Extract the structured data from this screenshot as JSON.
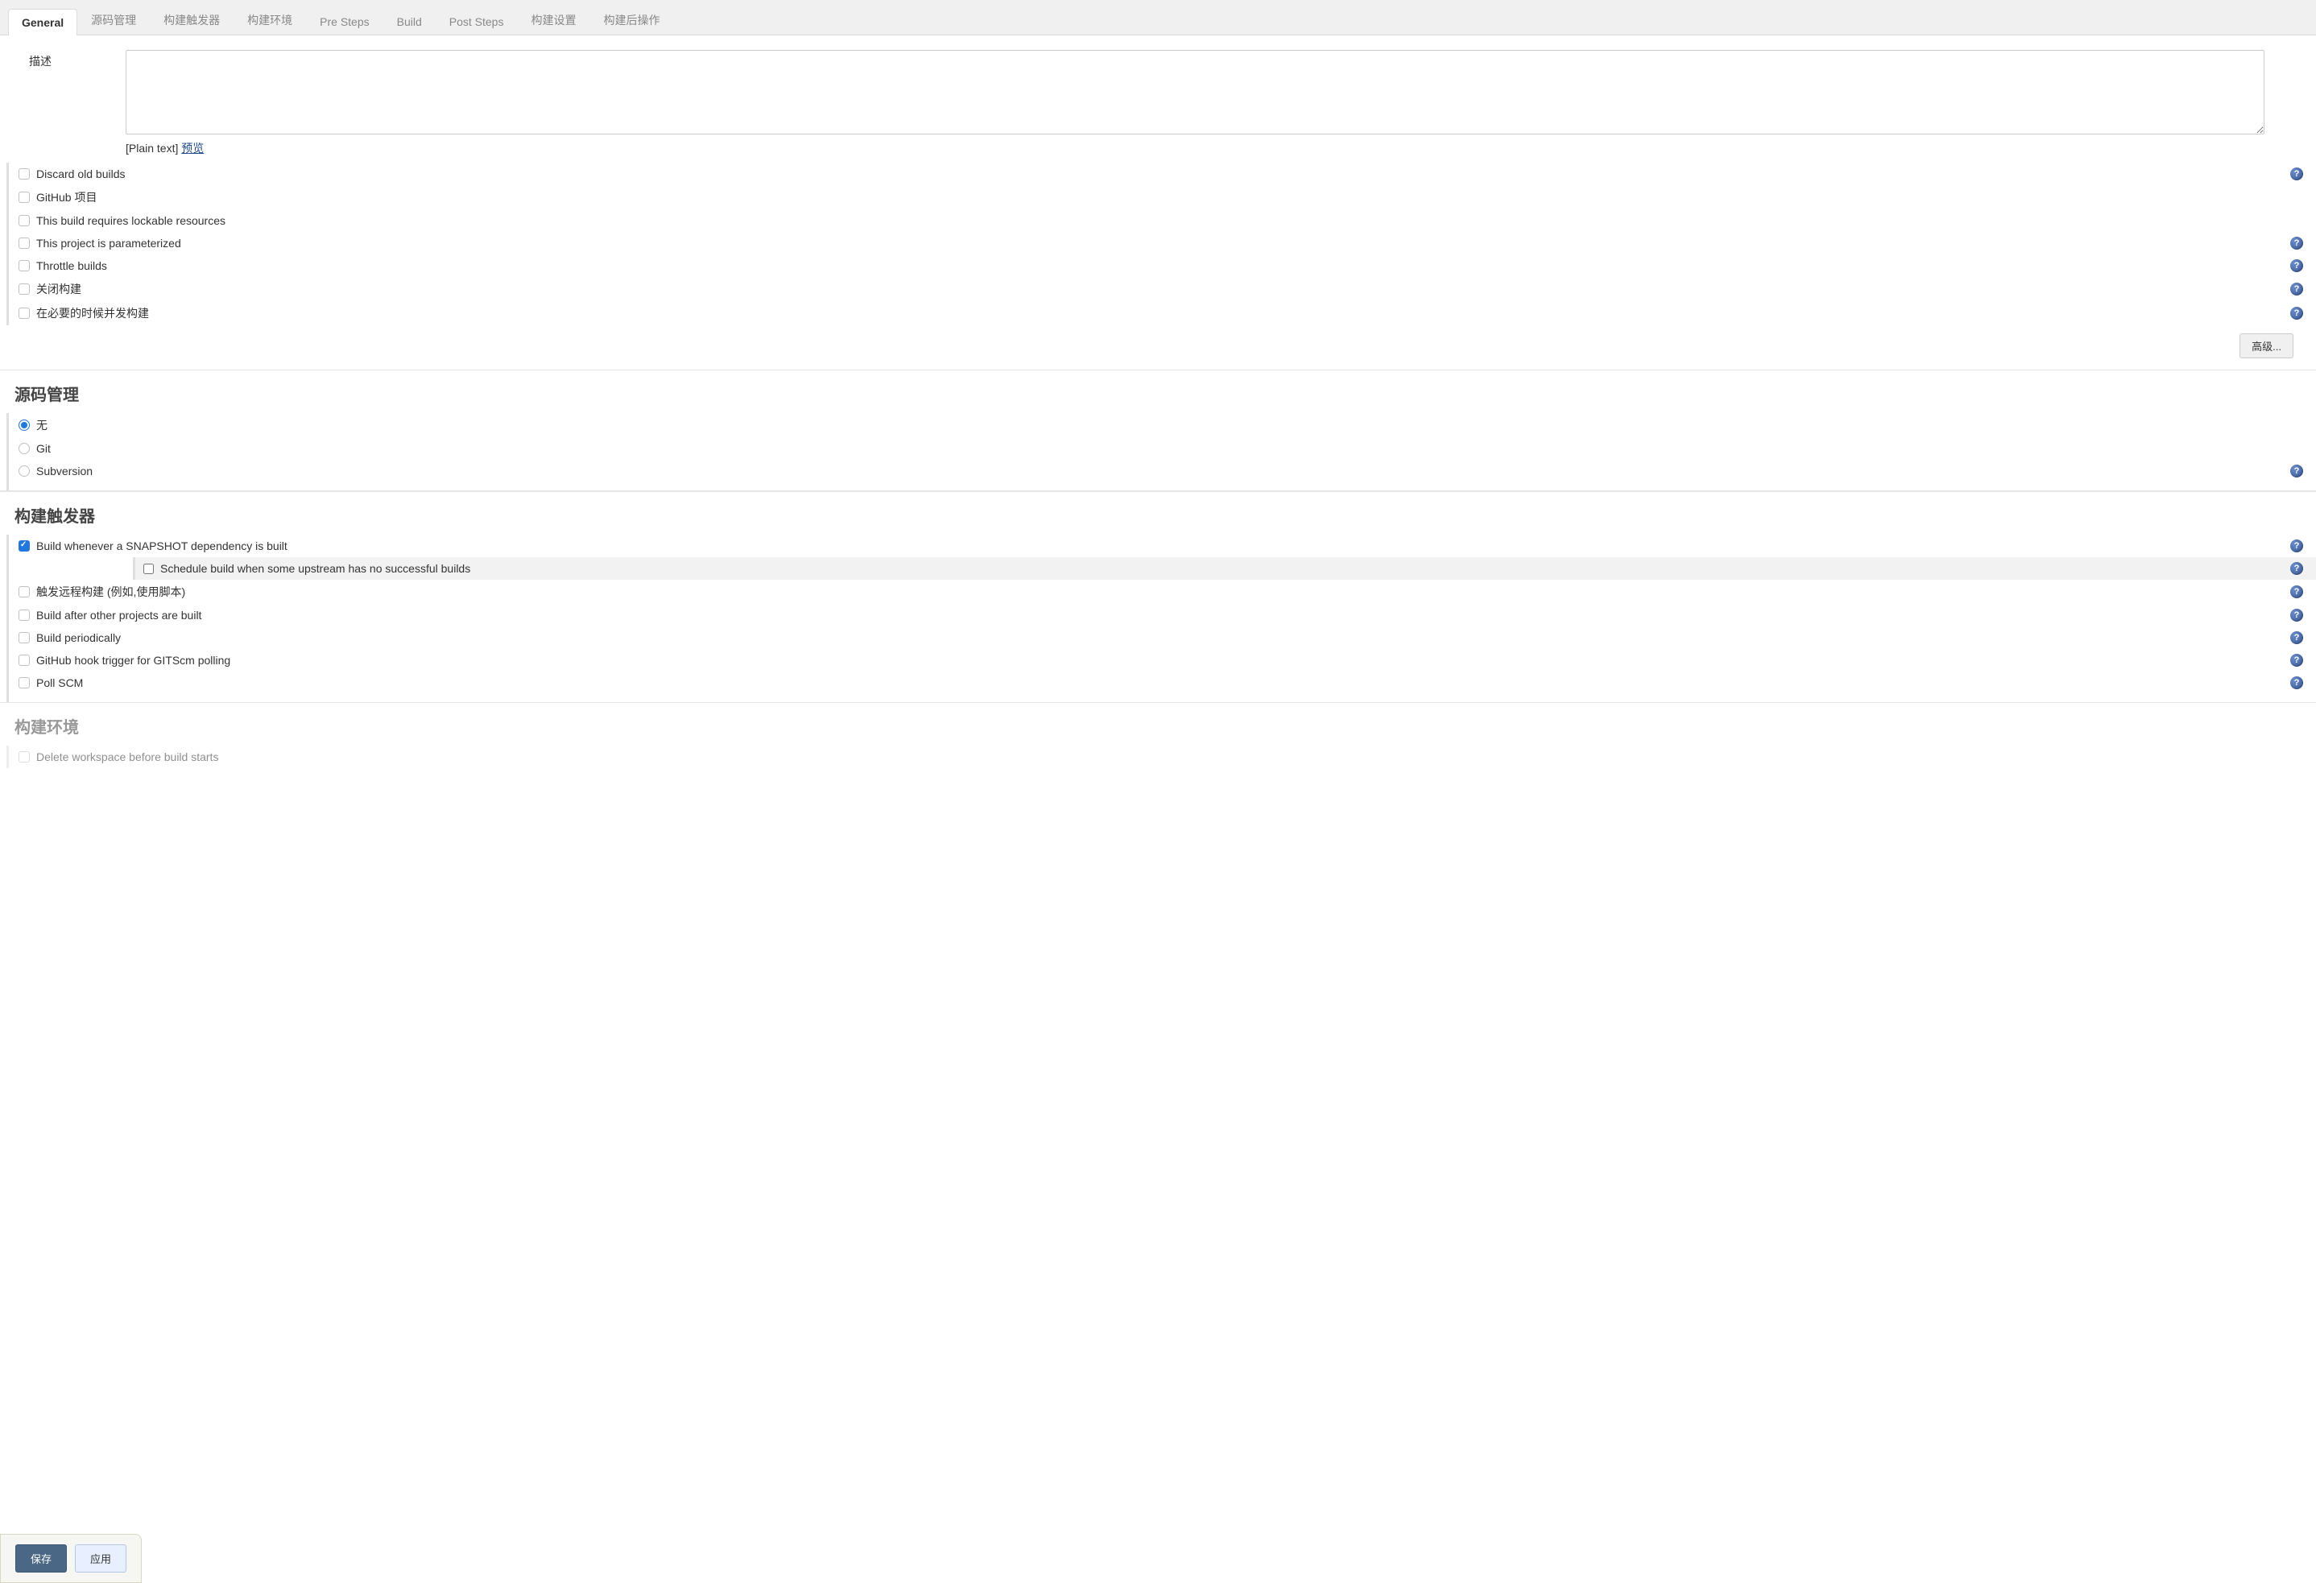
{
  "tabs": [
    {
      "label": "General",
      "active": true
    },
    {
      "label": "源码管理",
      "active": false
    },
    {
      "label": "构建触发器",
      "active": false
    },
    {
      "label": "构建环境",
      "active": false
    },
    {
      "label": "Pre Steps",
      "active": false
    },
    {
      "label": "Build",
      "active": false
    },
    {
      "label": "Post Steps",
      "active": false
    },
    {
      "label": "构建设置",
      "active": false
    },
    {
      "label": "构建后操作",
      "active": false
    }
  ],
  "description": {
    "label": "描述",
    "value": "",
    "plain_text_prefix": "[Plain text] ",
    "preview_link": "预览"
  },
  "general_options": [
    {
      "label": "Discard old builds",
      "checked": false,
      "help": true
    },
    {
      "label": "GitHub 项目",
      "checked": false,
      "help": false
    },
    {
      "label": "This build requires lockable resources",
      "checked": false,
      "help": false
    },
    {
      "label": "This project is parameterized",
      "checked": false,
      "help": true
    },
    {
      "label": "Throttle builds",
      "checked": false,
      "help": true
    },
    {
      "label": "关闭构建",
      "checked": false,
      "help": true
    },
    {
      "label": "在必要的时候并发构建",
      "checked": false,
      "help": true
    }
  ],
  "advanced_button": "高级...",
  "scm": {
    "heading": "源码管理",
    "options": [
      {
        "label": "无",
        "checked": true,
        "help": false
      },
      {
        "label": "Git",
        "checked": false,
        "help": false
      },
      {
        "label": "Subversion",
        "checked": false,
        "help": true
      }
    ]
  },
  "triggers": {
    "heading": "构建触发器",
    "options": [
      {
        "label": "Build whenever a SNAPSHOT dependency is built",
        "checked": true,
        "help": true,
        "nested": {
          "label": "Schedule build when some upstream has no successful builds",
          "checked": false,
          "help": true
        }
      },
      {
        "label": "触发远程构建 (例如,使用脚本)",
        "checked": false,
        "help": true
      },
      {
        "label": "Build after other projects are built",
        "checked": false,
        "help": true
      },
      {
        "label": "Build periodically",
        "checked": false,
        "help": true
      },
      {
        "label": "GitHub hook trigger for GITScm polling",
        "checked": false,
        "help": true
      },
      {
        "label": "Poll SCM",
        "checked": false,
        "help": true
      }
    ]
  },
  "build_env": {
    "heading": "构建环境",
    "options": [
      {
        "label": "Delete workspace before build starts",
        "checked": false,
        "help": false
      }
    ]
  },
  "footer": {
    "save": "保存",
    "apply": "应用"
  },
  "icons": {
    "help_glyph": "?"
  }
}
